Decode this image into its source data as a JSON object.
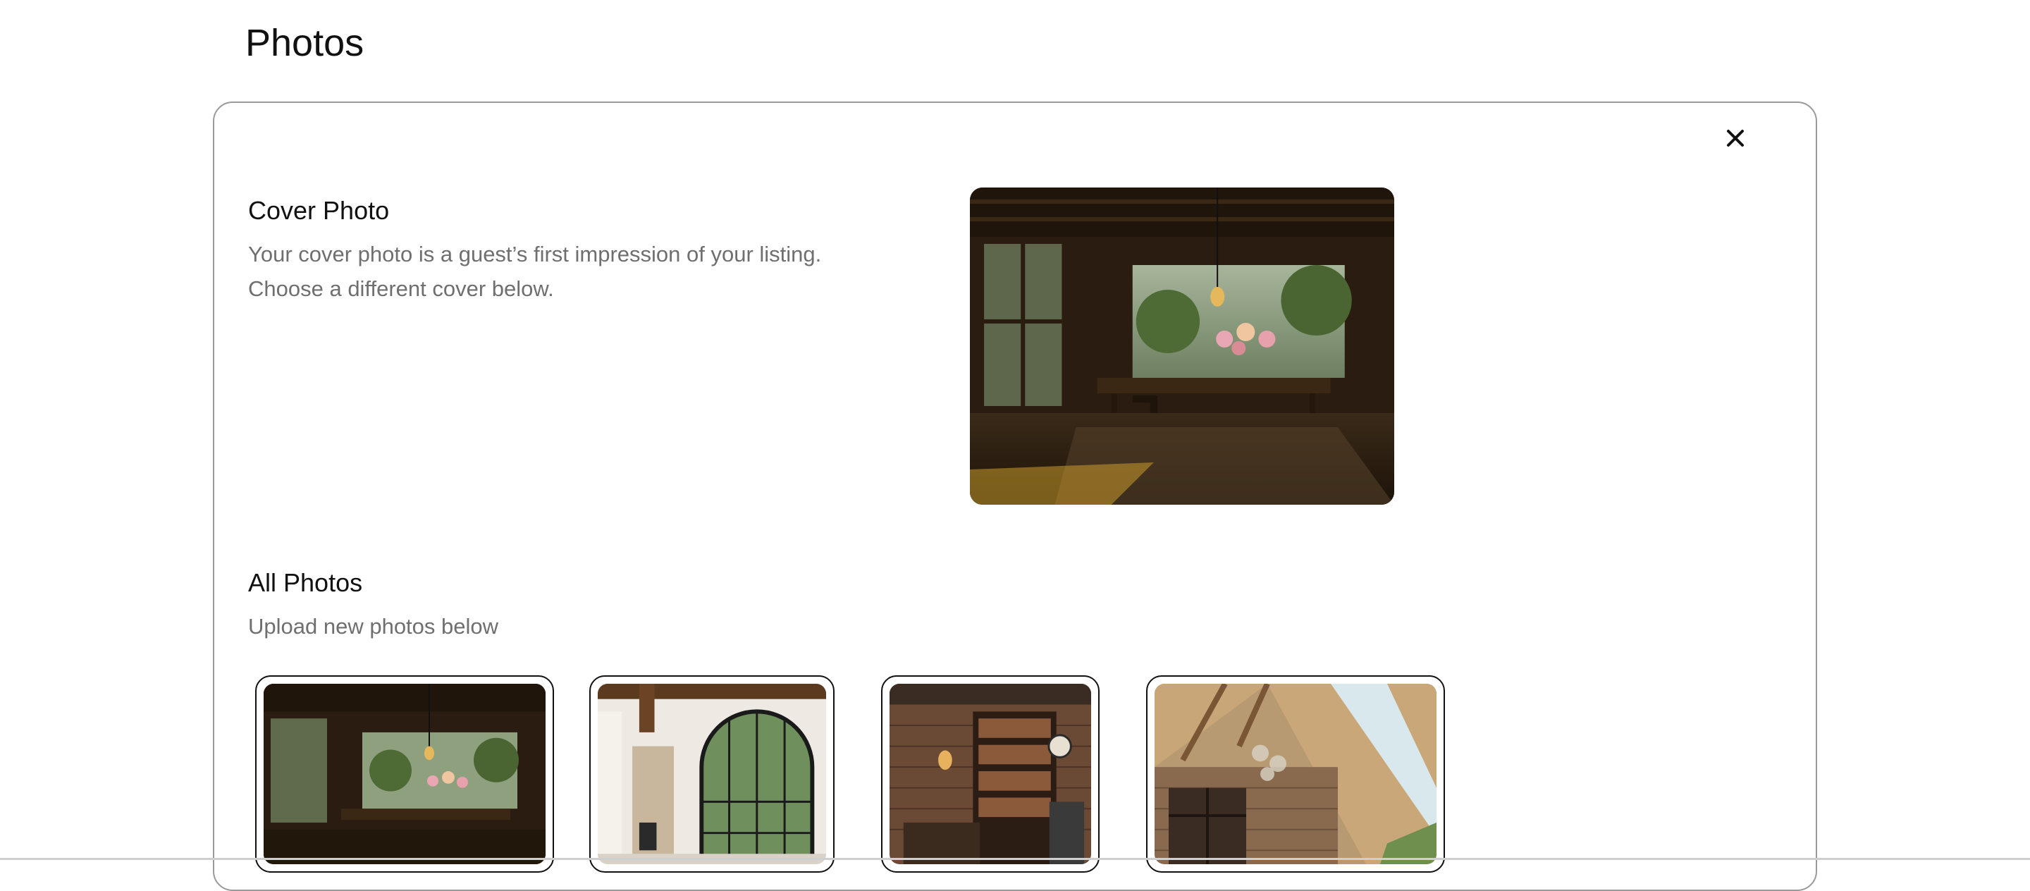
{
  "page": {
    "title": "Photos"
  },
  "panel": {
    "close_icon": "close-icon"
  },
  "cover": {
    "title": "Cover Photo",
    "description_line1": "Your cover photo is a guest’s first impression of your listing.",
    "description_line2": "Choose a different cover below."
  },
  "all_photos": {
    "title": "All Photos",
    "subtitle": "Upload new photos below"
  },
  "colors": {
    "text": "#111111",
    "muted": "#6f6f6f",
    "border": "#9a9a9a"
  }
}
